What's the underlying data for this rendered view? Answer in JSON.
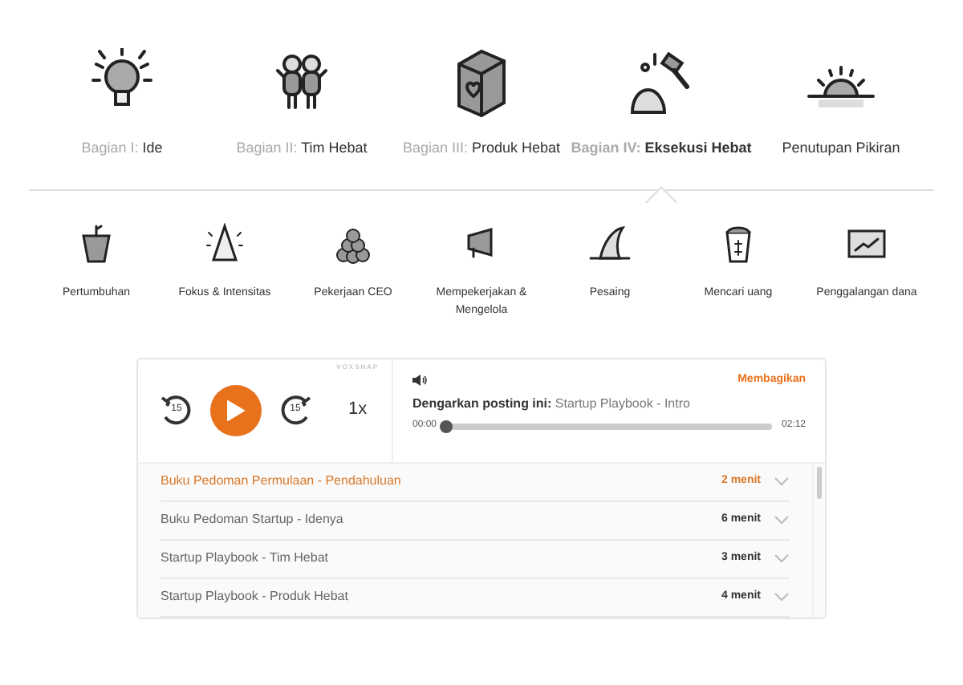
{
  "parts": [
    {
      "prefix": "Bagian I:",
      "name": "Ide",
      "selected": false,
      "kind": "bulb"
    },
    {
      "prefix": "Bagian II:",
      "name": "Tim Hebat",
      "selected": false,
      "kind": "people"
    },
    {
      "prefix": "Bagian III:",
      "name": "Produk Hebat",
      "selected": false,
      "kind": "box"
    },
    {
      "prefix": "Bagian IV:",
      "name": "Eksekusi Hebat",
      "selected": true,
      "kind": "hammer"
    },
    {
      "name": "Penutupan Pikiran",
      "selected": false,
      "kind": "sunset"
    }
  ],
  "chapters": [
    {
      "label": "Pertumbuhan",
      "kind": "pot"
    },
    {
      "label": "Fokus & Intensitas",
      "kind": "cone"
    },
    {
      "label": "Pekerjaan CEO",
      "kind": "balls"
    },
    {
      "label": "Mempekerjakan & Mengelola",
      "kind": "megaphone"
    },
    {
      "label": "Pesaing",
      "kind": "fin"
    },
    {
      "label": "Mencari uang",
      "kind": "bucket"
    },
    {
      "label": "Penggalangan dana",
      "kind": "chart"
    }
  ],
  "player": {
    "brand": "VOXSNAP",
    "back": "15",
    "forward": "15",
    "speed": "1x",
    "share": "Membagikan",
    "listen_label": "Dengarkan posting ini:",
    "listen_title": "Startup Playbook - Intro",
    "elapsed": "00:00",
    "duration": "02:12",
    "level": 0,
    "playlist": [
      {
        "title": "Buku Pedoman Permulaan - Pendahuluan",
        "length": "2 menit",
        "selected": true
      },
      {
        "title": "Buku Pedoman Startup - Idenya",
        "length": "6 menit",
        "selected": false
      },
      {
        "title": "Startup Playbook - Tim Hebat",
        "length": "3 menit",
        "selected": false
      },
      {
        "title": "Startup Playbook - Produk Hebat",
        "length": "4 menit",
        "selected": false
      }
    ]
  }
}
